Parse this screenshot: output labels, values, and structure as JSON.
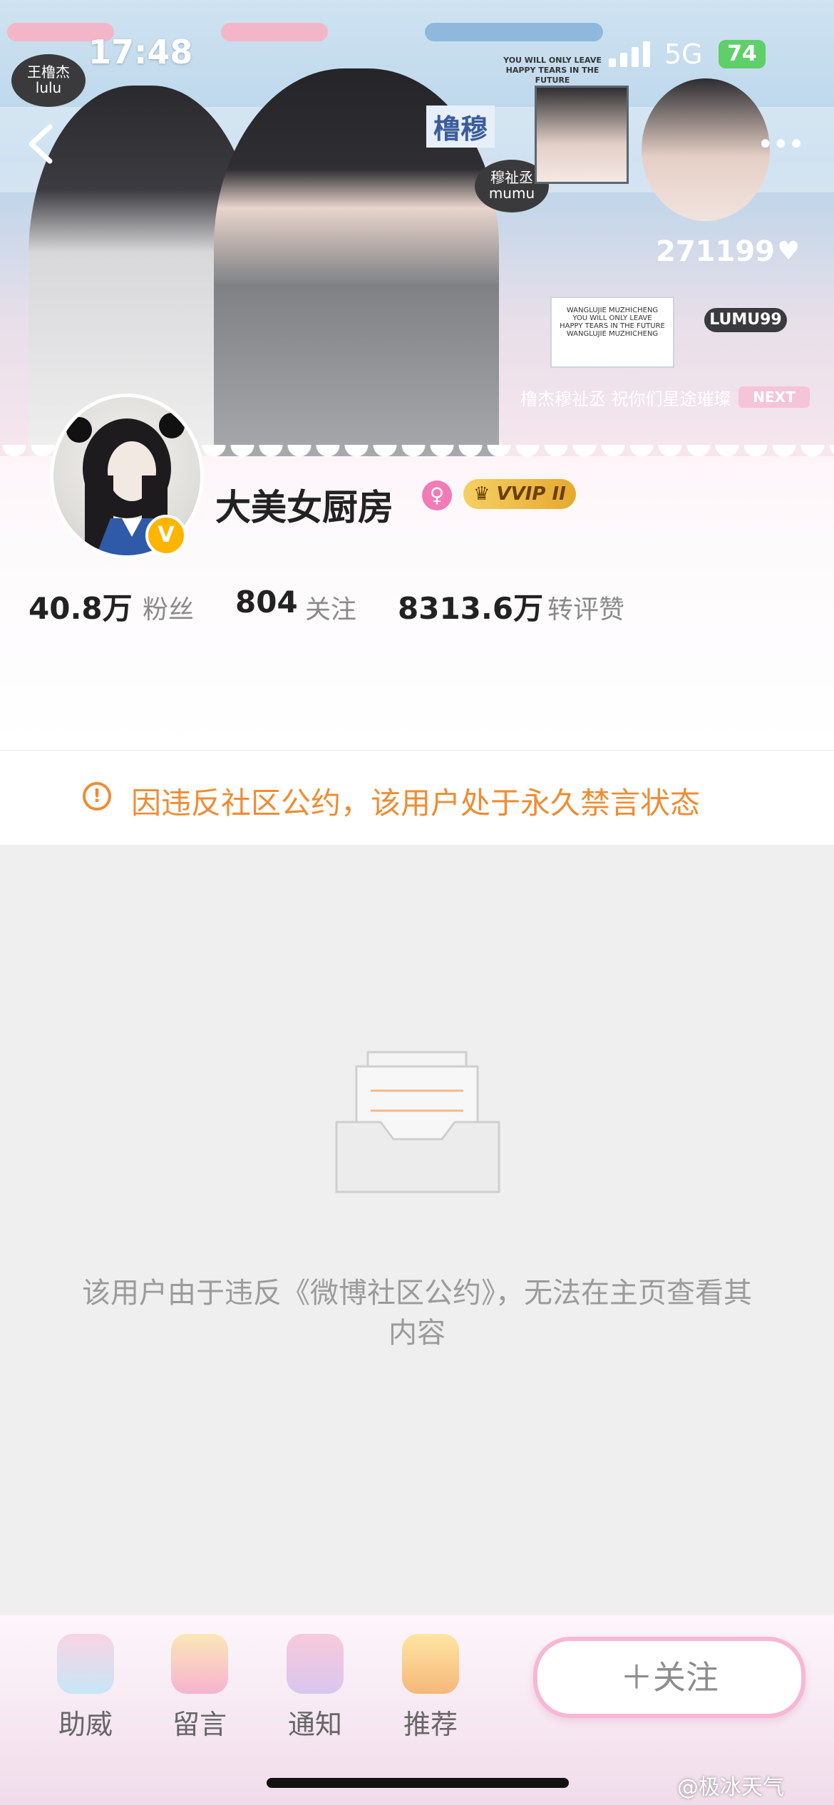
{
  "status_bar": {
    "time": "17:48",
    "network": "5G",
    "battery": "74"
  },
  "banner": {
    "tag_left_line1": "王橹杰",
    "tag_left_line2": "lulu",
    "tag_right_line1": "穆祉丞",
    "tag_right_line2": "mumu",
    "tagline": "YOU WILL ONLY LEAVE HAPPY TEARS IN THE FUTURE",
    "name_sign": "橹穆",
    "number": "271199",
    "card_lines": [
      "WANGLUJIE MUZHICHENG",
      "YOU WILL ONLY LEAVE",
      "HAPPY TEARS IN THE FUTURE",
      "WANGLUJIE MUZHICHENG"
    ],
    "chip": "LUMU99",
    "ticker": "橹杰穆祉丞 祝你们星途璀璨",
    "next_label": "NEXT"
  },
  "profile": {
    "username": "大美女厨房",
    "vip_badge": "VVIP II",
    "verified": "V",
    "stats": [
      {
        "value": "40.8万",
        "label": "粉丝"
      },
      {
        "value": "804",
        "label": "关注"
      },
      {
        "value": "8313.6万",
        "label": "转评赞"
      }
    ]
  },
  "notice": {
    "text": "因违反社区公约，该用户处于永久禁言状态"
  },
  "empty_state": {
    "text": "该用户由于违反《微博社区公约》，无法在主页查看其内容"
  },
  "tabbar": {
    "tabs": [
      {
        "label": "助威"
      },
      {
        "label": "留言"
      },
      {
        "label": "通知"
      },
      {
        "label": "推荐"
      }
    ],
    "follow_label": "＋关注"
  },
  "watermark": "@极冰天气",
  "colors": {
    "accent_orange": "#ef8c33",
    "vvip_gold": "#e6a92f",
    "gender_pink": "#f17bb7"
  }
}
